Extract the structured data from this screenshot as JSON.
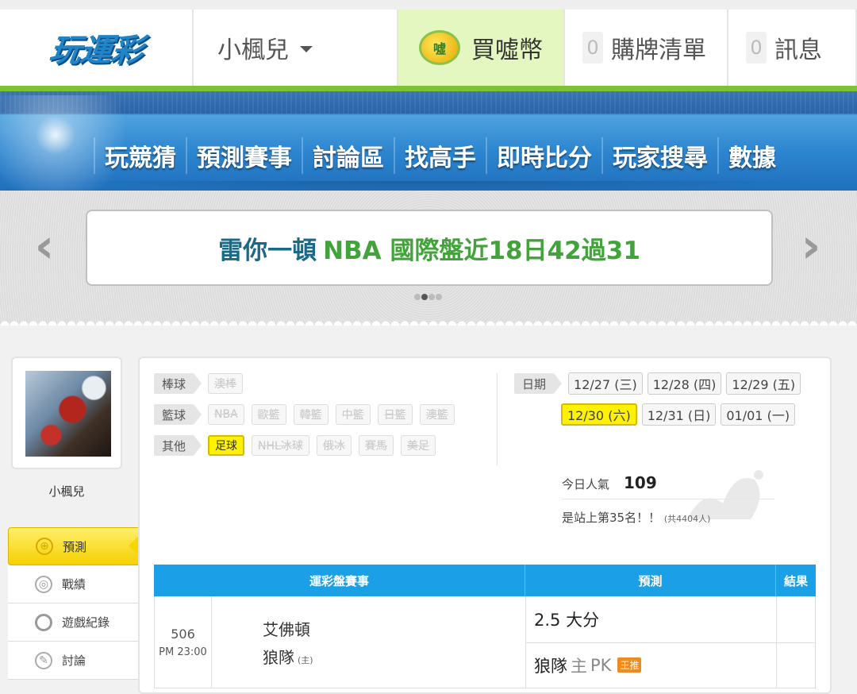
{
  "header": {
    "logo_text": "玩運彩",
    "username": "小楓兒",
    "coin_icon_text": "噓",
    "buy_coin_label": "買噓幣",
    "cart_count": "0",
    "cart_label": "購牌清單",
    "messages_count": "0",
    "messages_label": "訊息"
  },
  "nav": {
    "items": [
      "玩競猜",
      "預測賽事",
      "討論區",
      "找高手",
      "即時比分",
      "玩家搜尋",
      "數據"
    ]
  },
  "banner": {
    "name": "雷你一頓",
    "text": "NBA 國際盤近18日42過31",
    "prev_arrow": "‹",
    "next_arrow": "›"
  },
  "sidebar": {
    "username": "小楓兒",
    "menu": [
      {
        "label": "預測",
        "icon": "target-icon",
        "active": true
      },
      {
        "label": "戰績",
        "icon": "record-icon"
      },
      {
        "label": "遊戲紀錄",
        "icon": "circle-icon"
      },
      {
        "label": "討論",
        "icon": "edit-icon"
      }
    ]
  },
  "filters": {
    "baseball_label": "棒球",
    "baseball_items": [
      "澳棒"
    ],
    "basketball_label": "籃球",
    "basketball_items": [
      "NBA",
      "歐籃",
      "韓籃",
      "中籃",
      "日籃",
      "澳籃"
    ],
    "other_label": "其他",
    "other_items": [
      "足球",
      "NHL冰球",
      "俄冰",
      "賽馬",
      "美足"
    ],
    "other_active": "足球",
    "date_label": "日期",
    "dates_row1": [
      "12/27 (三)",
      "12/28 (四)",
      "12/29 (五)"
    ],
    "dates_row2": [
      "12/30 (六)",
      "12/31 (日)",
      "01/01 (一)"
    ],
    "date_active": "12/30 (六)"
  },
  "popularity": {
    "label": "今日人氣",
    "value": "109",
    "rank_text": "是站上第35名！！",
    "total_text": "(共4404人)"
  },
  "table": {
    "headers": [
      "運彩盤賽事",
      "預測",
      "結果"
    ],
    "row": {
      "game_no": "506",
      "time": "PM 23:00",
      "team1": "艾佛頓",
      "team2": "狼隊",
      "team2_tag": "(主)",
      "pred1": "2.5 大分",
      "pred2_team": "狼隊",
      "pred2_home": "主",
      "pred2_pk": "PK",
      "pred2_badge": "王推"
    }
  }
}
